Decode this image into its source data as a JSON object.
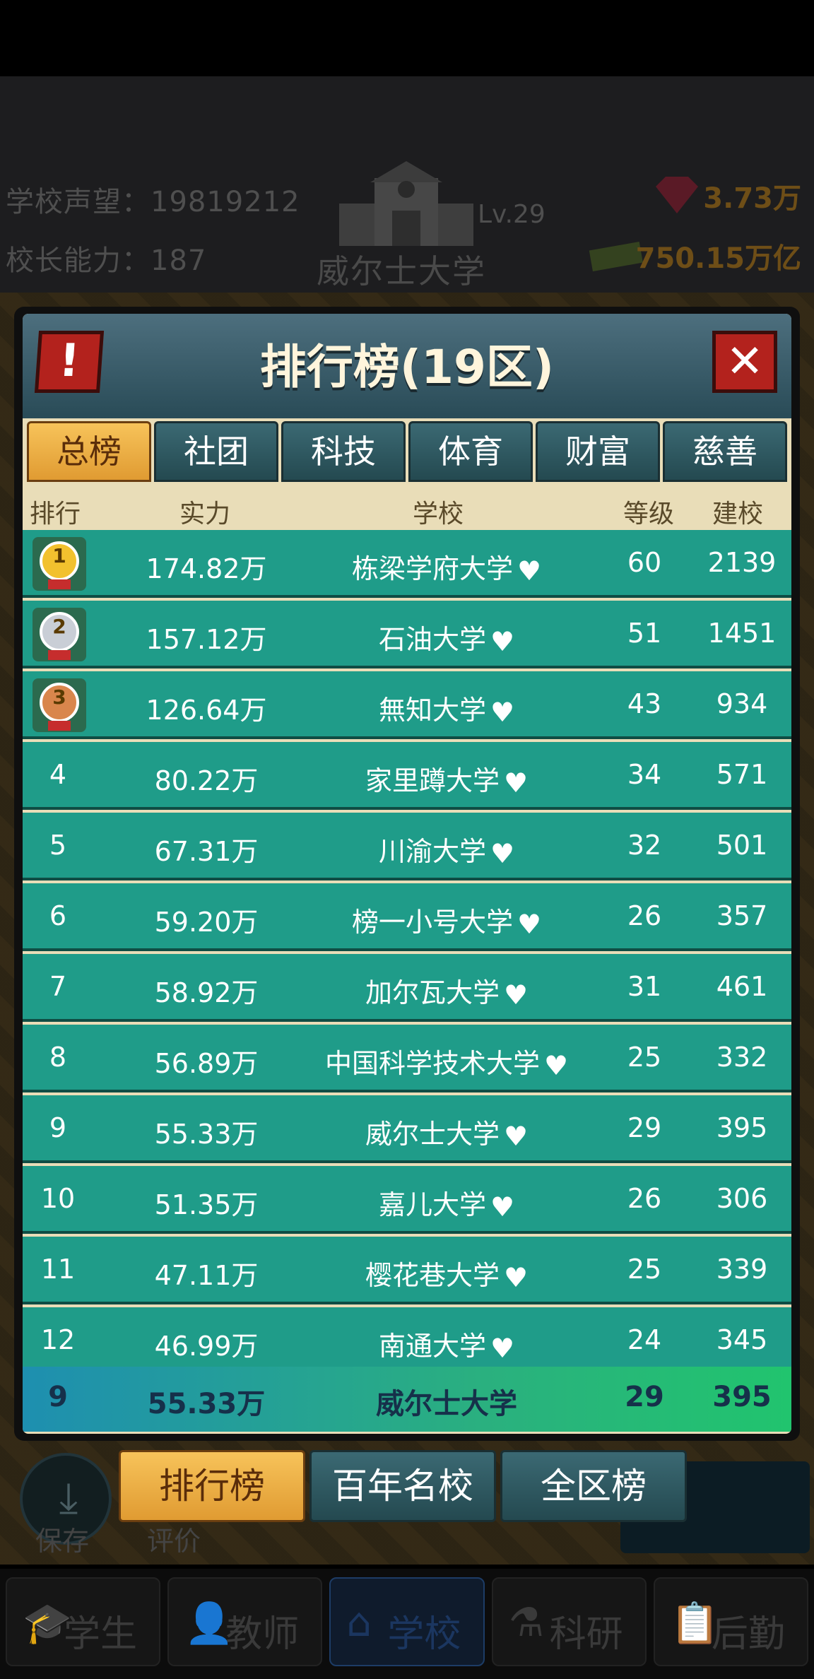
{
  "header": {
    "reputation_label": "学校声望：",
    "reputation_value": "19819212",
    "ability_label": "校长能力：",
    "ability_value": "187",
    "level": "Lv.29",
    "school_name": "威尔士大学",
    "gems": "3.73万",
    "money": "750.15万亿"
  },
  "panel": {
    "title": "排行榜(19区)",
    "alert_symbol": "!",
    "close_symbol": "✕"
  },
  "tabs": [
    "总榜",
    "社团",
    "科技",
    "体育",
    "财富",
    "慈善"
  ],
  "columns": {
    "rank": "排行",
    "power": "实力",
    "school": "学校",
    "level": "等级",
    "build": "建校"
  },
  "rows": [
    {
      "rank": "1",
      "power": "174.82万",
      "school": "栋梁学府大学",
      "level": "60",
      "build": "2139"
    },
    {
      "rank": "2",
      "power": "157.12万",
      "school": "石油大学",
      "level": "51",
      "build": "1451"
    },
    {
      "rank": "3",
      "power": "126.64万",
      "school": "無知大学",
      "level": "43",
      "build": "934"
    },
    {
      "rank": "4",
      "power": "80.22万",
      "school": "家里蹲大学",
      "level": "34",
      "build": "571"
    },
    {
      "rank": "5",
      "power": "67.31万",
      "school": "川渝大学",
      "level": "32",
      "build": "501"
    },
    {
      "rank": "6",
      "power": "59.20万",
      "school": "榜一小号大学",
      "level": "26",
      "build": "357"
    },
    {
      "rank": "7",
      "power": "58.92万",
      "school": "加尔瓦大学",
      "level": "31",
      "build": "461"
    },
    {
      "rank": "8",
      "power": "56.89万",
      "school": "中国科学技术大学",
      "level": "25",
      "build": "332"
    },
    {
      "rank": "9",
      "power": "55.33万",
      "school": "威尔士大学",
      "level": "29",
      "build": "395"
    },
    {
      "rank": "10",
      "power": "51.35万",
      "school": "嘉儿大学",
      "level": "26",
      "build": "306"
    },
    {
      "rank": "11",
      "power": "47.11万",
      "school": "樱花巷大学",
      "level": "25",
      "build": "339"
    },
    {
      "rank": "12",
      "power": "46.99万",
      "school": "南通大学",
      "level": "24",
      "build": "345"
    }
  ],
  "my_row": {
    "rank": "9",
    "power": "55.33万",
    "school": "威尔士大学",
    "level": "29",
    "build": "395"
  },
  "bottom_tabs": [
    "排行榜",
    "百年名校",
    "全区榜"
  ],
  "side_labels": {
    "save": "保存",
    "rate": "评价"
  },
  "nav": [
    {
      "label": "学生",
      "icon": "student-icon"
    },
    {
      "label": "教师",
      "icon": "teacher-icon"
    },
    {
      "label": "学校",
      "icon": "school-icon"
    },
    {
      "label": "科研",
      "icon": "flask-icon"
    },
    {
      "label": "后勤",
      "icon": "clipboard-icon"
    }
  ],
  "colors": {
    "row_bg": "#1f9c89",
    "active_tab": "#f0b148",
    "heart": "#f06a6f"
  }
}
